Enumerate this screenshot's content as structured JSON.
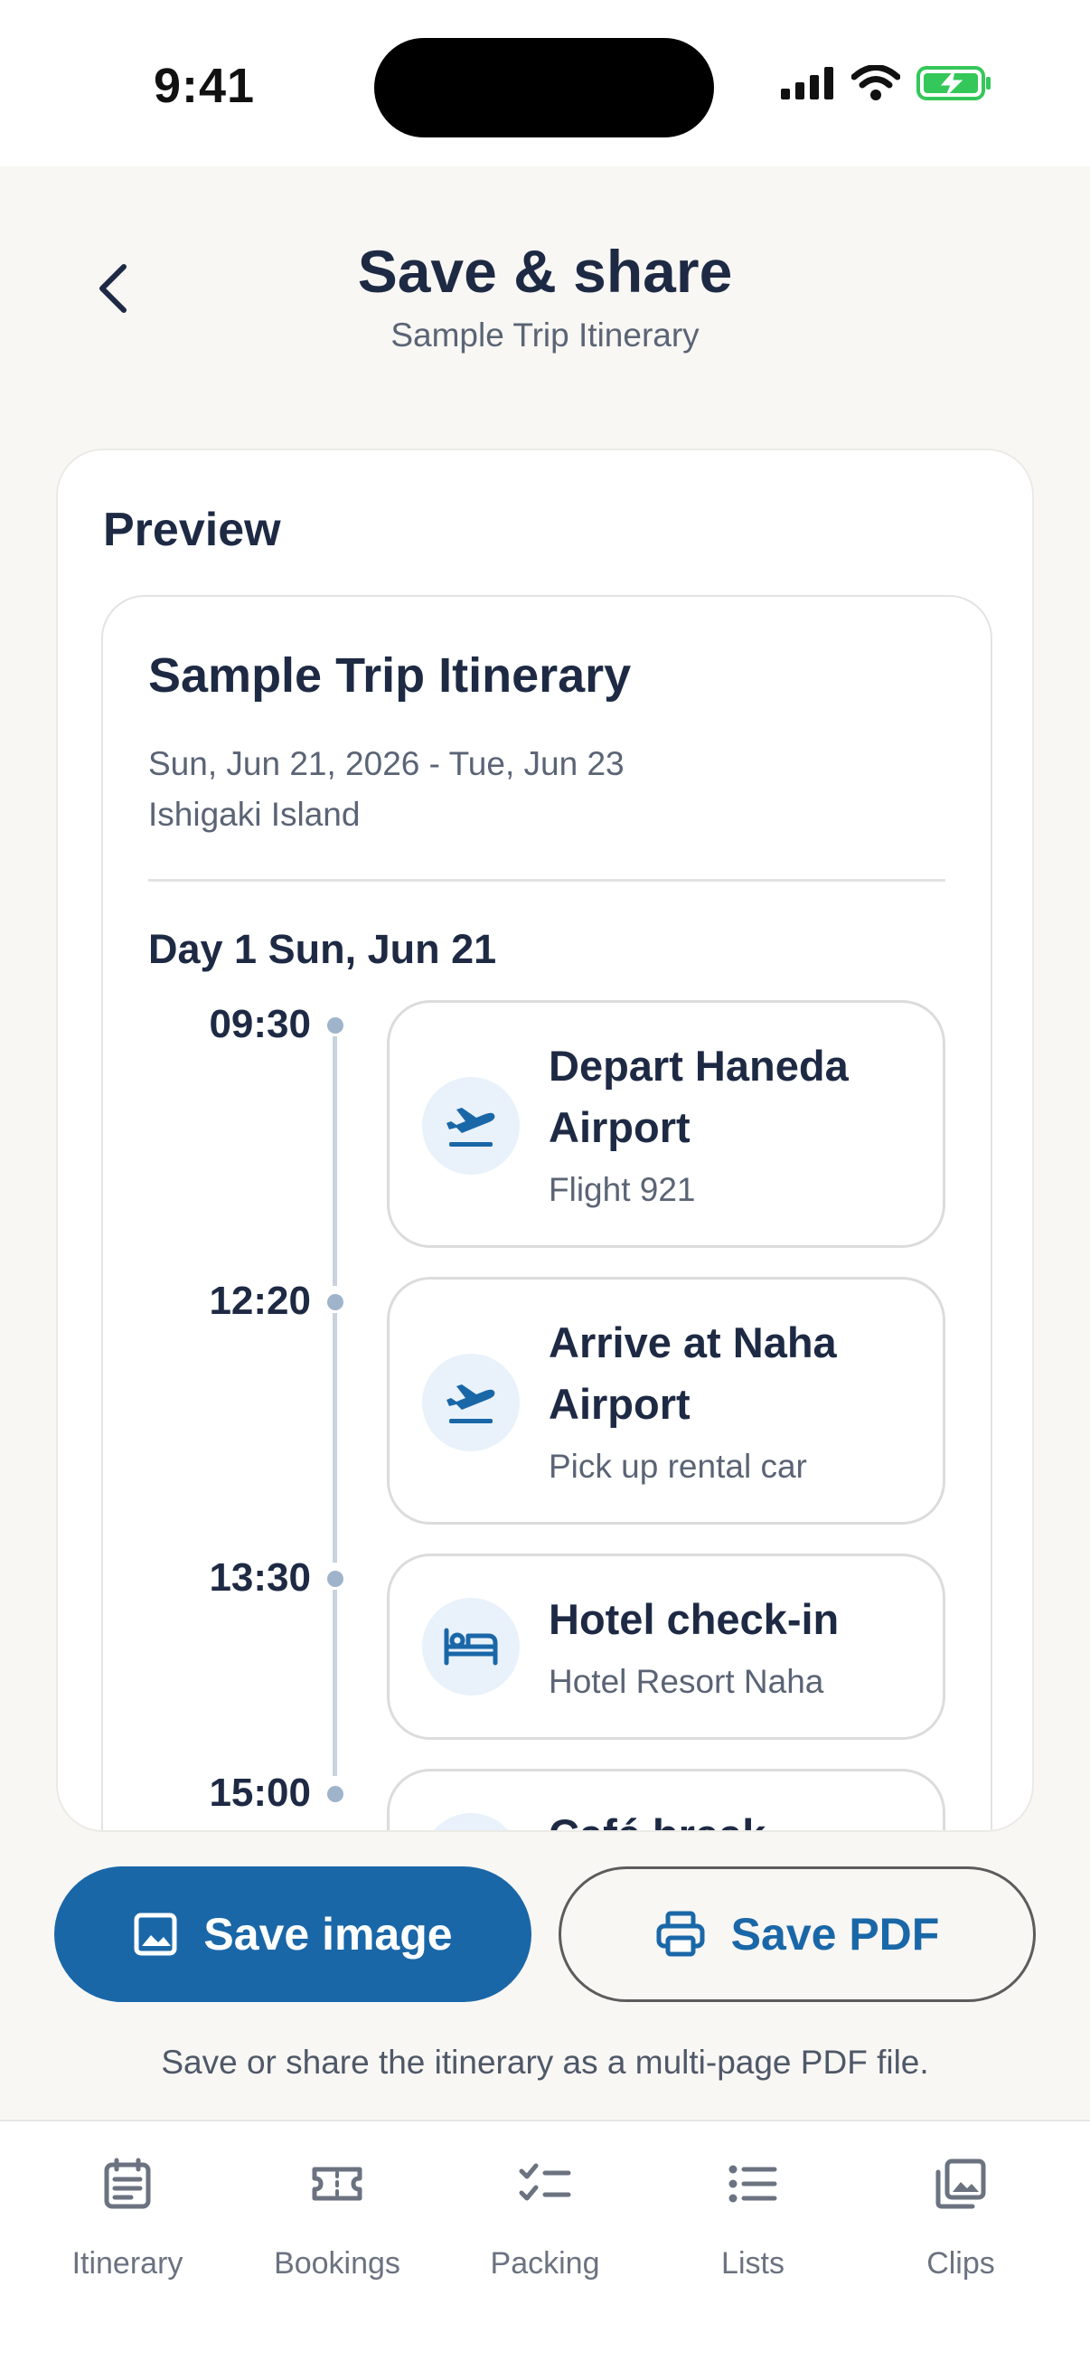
{
  "status": {
    "time": "9:41"
  },
  "header": {
    "title": "Save & share",
    "subtitle": "Sample Trip Itinerary"
  },
  "preview": {
    "label": "Preview",
    "trip_title": "Sample Trip Itinerary",
    "dates": "Sun, Jun 21, 2026 - Tue, Jun 23",
    "place": "Ishigaki Island",
    "day_heading": "Day 1 Sun, Jun 21",
    "events": [
      {
        "time": "09:30",
        "title": "Depart Haneda Airport",
        "sub": "Flight 921",
        "icon": "departure-icon"
      },
      {
        "time": "12:20",
        "title": "Arrive at Naha Airport",
        "sub": "Pick up rental car",
        "icon": "departure-icon"
      },
      {
        "time": "13:30",
        "title": "Hotel check-in",
        "sub": "Hotel Resort Naha",
        "icon": "bed-icon"
      },
      {
        "time": "15:00",
        "title": "Café break",
        "sub": "",
        "icon": "cafe-icon"
      }
    ]
  },
  "actions": {
    "save_image": "Save image",
    "save_pdf": "Save PDF",
    "note": "Save or share the itinerary as a multi-page PDF file."
  },
  "tabs": [
    {
      "label": "Itinerary",
      "icon": "calendar-list-icon"
    },
    {
      "label": "Bookings",
      "icon": "ticket-icon"
    },
    {
      "label": "Packing",
      "icon": "checklist-icon"
    },
    {
      "label": "Lists",
      "icon": "list-icon"
    },
    {
      "label": "Clips",
      "icon": "gallery-icon"
    }
  ],
  "colors": {
    "accent": "#1a67a8",
    "background": "#f8f7f4",
    "text": "#1e2a44",
    "battery": "#34c759"
  }
}
